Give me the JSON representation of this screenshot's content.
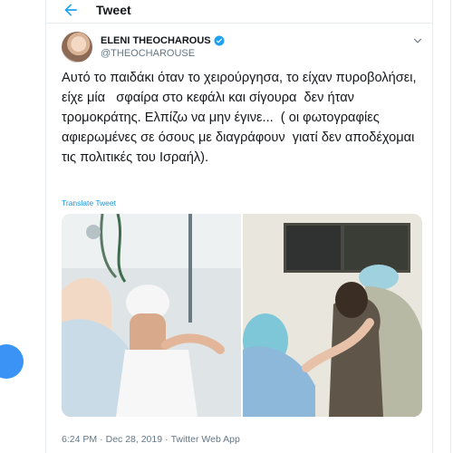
{
  "header": {
    "title": "Tweet",
    "back_icon": "arrow-left-icon"
  },
  "tweet": {
    "author_name": "ELENI THEOCHAROUS",
    "author_handle": "@THEOCHAROUSE",
    "verified_icon": "verified-badge-icon",
    "menu_icon": "chevron-down-icon",
    "text": "Αυτό το παιδάκι όταν το χειρούργησα, το είχαν πυροβολήσει, είχε μία   σφαίρα στο κεφάλι και σίγουρα  δεν ήταν τρομοκράτης. Ελπίζω να μην έγινε...  ( οι φωτογραφίες αφιερωμένες σε όσους με διαγράφουν  γιατί δεν αποδέχομαι τις πολιτικές του Ισραήλ).",
    "translate_label": "Translate Tweet",
    "time": "6:24 PM",
    "date": "Dec 28, 2019",
    "separator": "·",
    "source": "Twitter Web App"
  },
  "colors": {
    "accent": "#1da1f2",
    "link": "#1b95e0",
    "muted": "#657786",
    "border": "#e6ecf0"
  }
}
